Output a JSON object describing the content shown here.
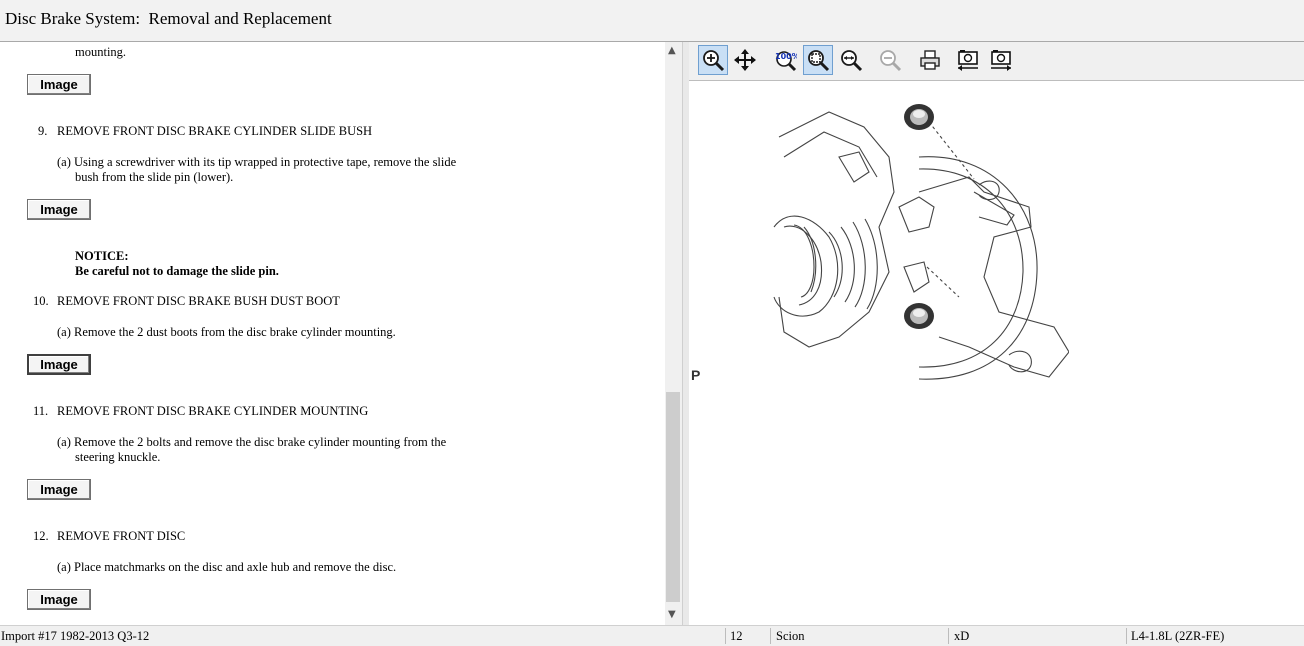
{
  "window": {
    "title": "Disc Brake System:  Removal and Replacement"
  },
  "document": {
    "top_fragment": "mounting.",
    "image_button_label": "Image",
    "steps": [
      {
        "number": "9.",
        "heading": "REMOVE FRONT DISC BRAKE CYLINDER SLIDE BUSH",
        "instruction_line1": "(a) Using a screwdriver with its tip wrapped in protective tape, remove the slide",
        "instruction_line2": "bush from the slide pin (lower).",
        "notice_title": "NOTICE:",
        "notice_text": "Be careful not to damage the slide pin."
      },
      {
        "number": "10.",
        "heading": "REMOVE FRONT DISC BRAKE BUSH DUST BOOT",
        "instruction_line1": "(a) Remove the 2 dust boots from the disc brake cylinder mounting."
      },
      {
        "number": "11.",
        "heading": "REMOVE FRONT DISC BRAKE CYLINDER MOUNTING",
        "instruction_line1": "(a) Remove the 2 bolts and remove the disc brake cylinder mounting from the",
        "instruction_line2": "steering knuckle."
      },
      {
        "number": "12.",
        "heading": "REMOVE FRONT DISC",
        "instruction_line1": "(a) Place matchmarks on the disc and axle hub and remove the disc."
      }
    ]
  },
  "viewer": {
    "toolbar_icons": [
      "zoom-in-icon",
      "pan-icon",
      "zoom-100-icon",
      "zoom-fit-icon",
      "zoom-window-icon",
      "zoom-out-icon",
      "print-icon",
      "previous-image-icon",
      "next-image-icon"
    ],
    "active_tools": [
      "zoom-in-icon",
      "zoom-fit-icon"
    ],
    "figure_label": "P"
  },
  "statusbar": {
    "source": "Import #17 1982-2013 Q3-12",
    "year": "12",
    "make": "Scion",
    "model": "xD",
    "engine": "L4-1.8L (2ZR-FE)"
  },
  "colors": {
    "active_tool_bg": "#c9dff5",
    "window_bg": "#f0f0f0"
  }
}
